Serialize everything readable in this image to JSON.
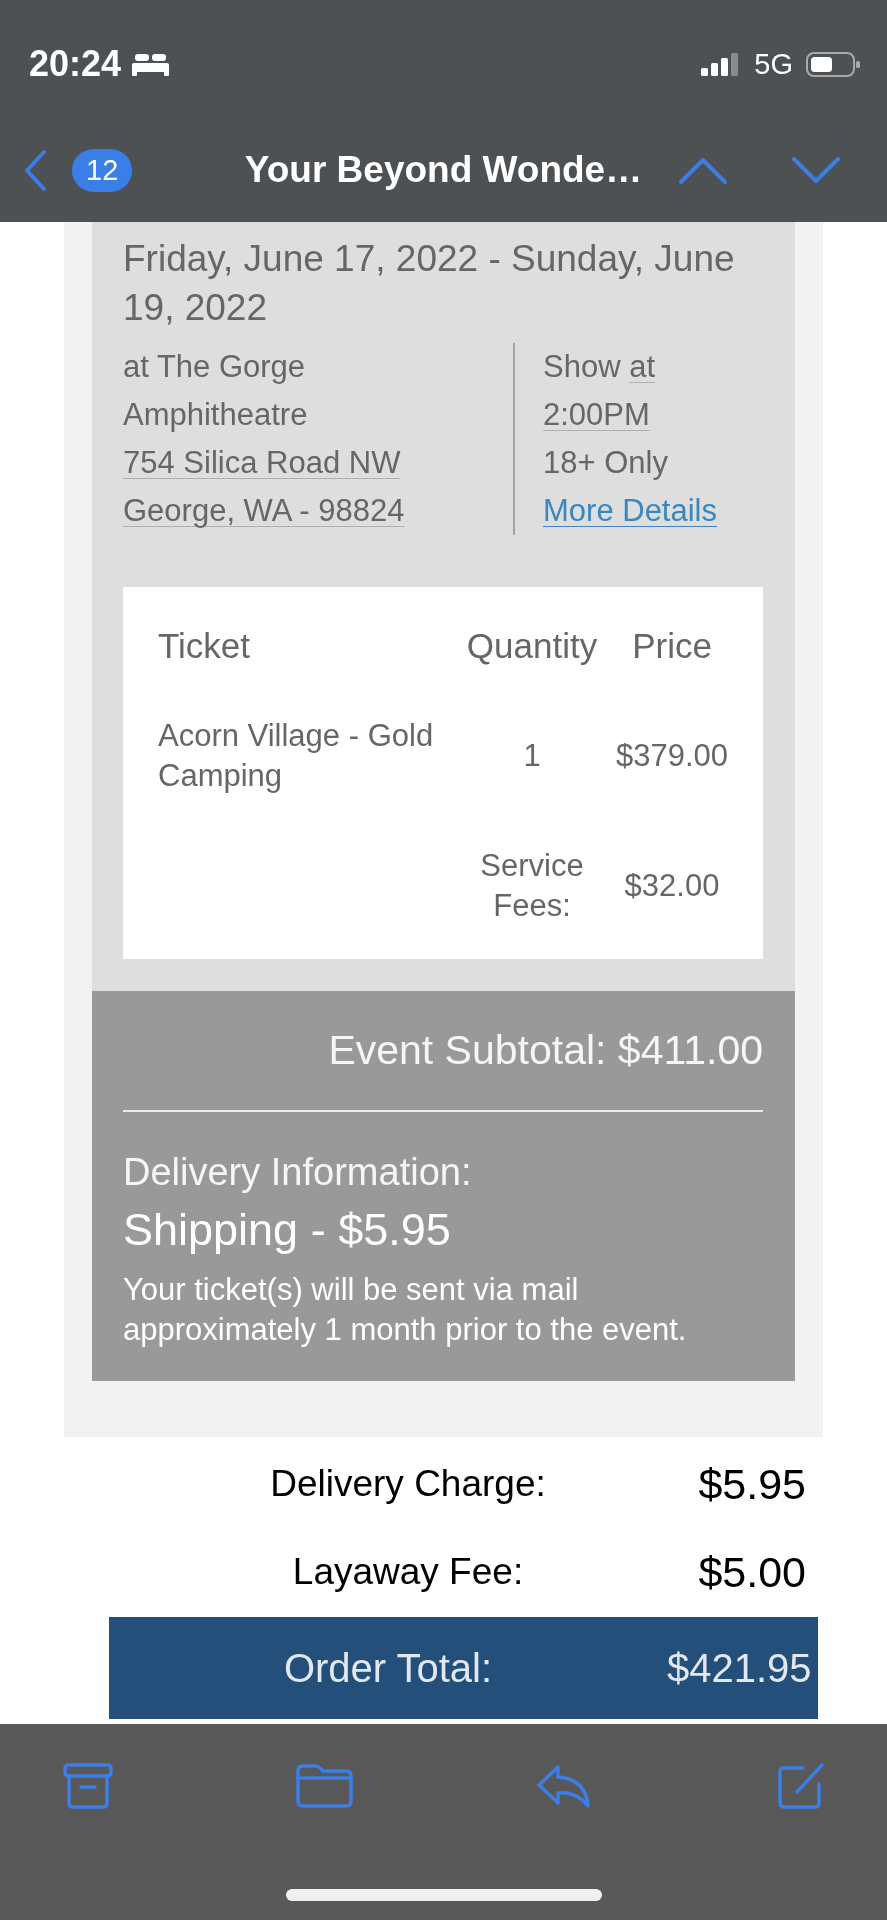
{
  "status_bar": {
    "time": "20:24",
    "network": "5G"
  },
  "nav_bar": {
    "unread_count": "12",
    "title": "Your Beyond Wonde…"
  },
  "event": {
    "dates": "Friday, June 17, 2022 - Sunday, June 19, 2022",
    "venue_lines": [
      {
        "segments": [
          {
            "text": "at The Gorge",
            "kind": "plain"
          }
        ]
      },
      {
        "segments": [
          {
            "text": "Amphitheatre",
            "kind": "plain"
          }
        ]
      },
      {
        "segments": [
          {
            "text": "754 Silica Road NW",
            "kind": "detected"
          }
        ]
      },
      {
        "segments": [
          {
            "text": "George, WA - 98824",
            "kind": "detected"
          }
        ]
      }
    ],
    "show_lines": [
      {
        "segments": [
          {
            "text": "Show",
            "kind": "plain"
          },
          {
            "text": "at",
            "kind": "detected"
          }
        ]
      },
      {
        "segments": [
          {
            "text": "2:00PM",
            "kind": "detected"
          }
        ]
      },
      {
        "segments": [
          {
            "text": "18+ Only",
            "kind": "plain"
          }
        ]
      },
      {
        "segments": [
          {
            "text": "More Details",
            "kind": "link"
          }
        ]
      }
    ]
  },
  "tickets": {
    "columns": [
      "Ticket",
      "Quantity",
      "Price"
    ],
    "rows": [
      {
        "ticket": "Acorn Village - Gold Camping",
        "quantity": "1",
        "price": "$379.00"
      }
    ],
    "service_fees": {
      "label": "Service Fees:",
      "amount": "$32.00"
    }
  },
  "event_subtotal": "Event Subtotal: $411.00",
  "delivery": {
    "heading": "Delivery Information:",
    "method": "Shipping - $5.95",
    "note": "Your ticket(s) will be sent via mail approximately 1 month prior to the event."
  },
  "charges": [
    {
      "label": "Delivery Charge:",
      "amount": "$5.95"
    },
    {
      "label": "Layaway Fee:",
      "amount": "$5.00"
    }
  ],
  "order_total": {
    "label": "Order Total:",
    "amount": "$421.95"
  }
}
